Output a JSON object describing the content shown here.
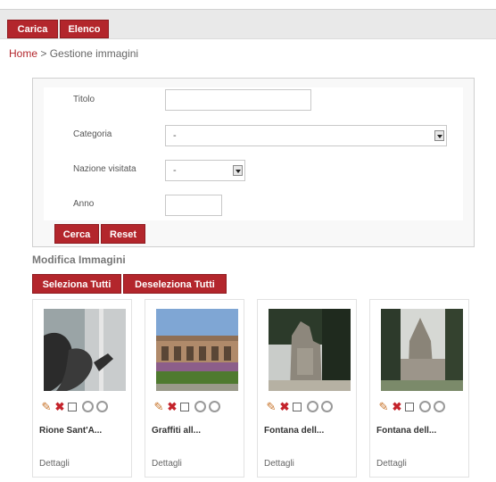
{
  "toolbar": {
    "carica": "Carica",
    "elenco": "Elenco"
  },
  "breadcrumb": {
    "home": "Home",
    "separator": ">",
    "current": "Gestione immagini"
  },
  "search": {
    "titolo_label": "Titolo",
    "titolo_value": "",
    "categoria_label": "Categoria",
    "categoria_value": "-",
    "nazione_label": "Nazione visitata",
    "nazione_value": "-",
    "anno_label": "Anno",
    "anno_value": "",
    "cerca": "Cerca",
    "reset": "Reset"
  },
  "images_section": {
    "title": "Modifica Immagini",
    "select_all": "Seleziona Tutti",
    "deselect_all": "Deseleziona Tutti",
    "items": [
      {
        "title": "Rione Sant'A...",
        "details": "Dettagli"
      },
      {
        "title": "Graffiti all...",
        "details": "Dettagli"
      },
      {
        "title": "Fontana dell...",
        "details": "Dettagli"
      },
      {
        "title": "Fontana dell...",
        "details": "Dettagli"
      }
    ],
    "icons": [
      "pencil-icon",
      "delete-icon",
      "checkbox",
      "rotate-left-icon",
      "rotate-right-icon"
    ]
  },
  "colors": {
    "accent": "#b3262c",
    "panel_bg": "#f8f8f8",
    "topbar_bg": "#e9e9e9"
  }
}
